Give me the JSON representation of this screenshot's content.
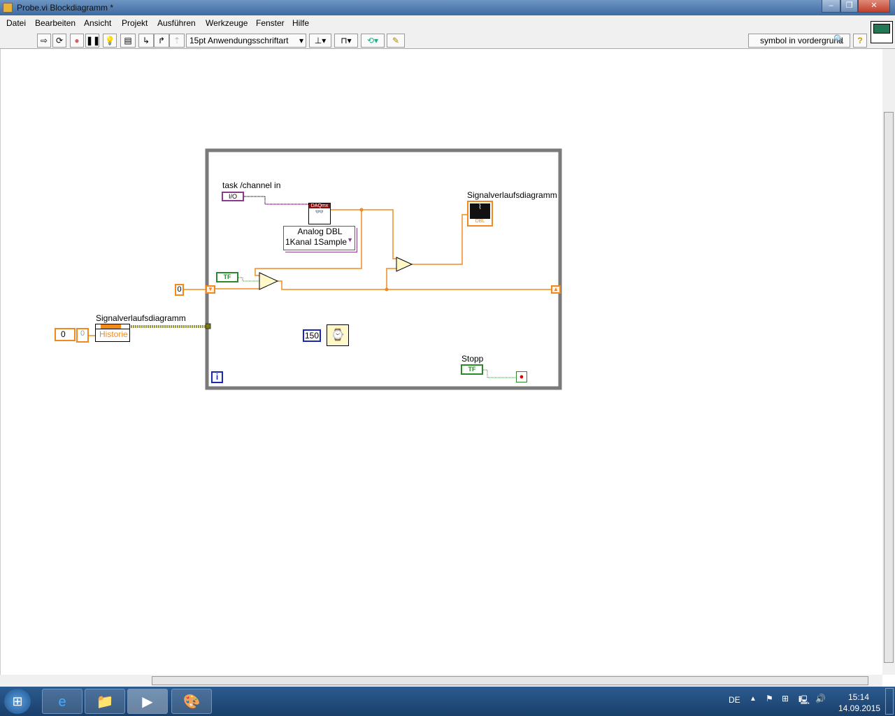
{
  "window": {
    "title": "Probe.vi Blockdiagramm *"
  },
  "menu": [
    "Datei",
    "Bearbeiten",
    "Ansicht",
    "Projekt",
    "Ausführen",
    "Werkzeuge",
    "Fenster",
    "Hilfe"
  ],
  "toolbar": {
    "font": "15pt Anwendungsschriftart",
    "search_value": "symbol in vordergrund",
    "help": "?"
  },
  "diagram": {
    "task_label": "task /channel in",
    "task_const": "I/O",
    "daqmx_label": "DAQmx",
    "daqmx_selector": [
      "Analog DBL",
      "1Kanal 1Sample"
    ],
    "chart_label_inner": "Signalverlaufsdiagramm",
    "chart_type": "DBL",
    "bool_const": "TF",
    "shift_init": "0",
    "property_label": "Signalverlaufsdiagramm",
    "property_item": "Historie",
    "array_index": "0",
    "array_elem": "0",
    "wait_value": "150",
    "stop_label": "Stopp",
    "iteration": "i"
  },
  "taskbar": {
    "lang": "DE",
    "time": "15:14",
    "date": "14.09.2015"
  }
}
